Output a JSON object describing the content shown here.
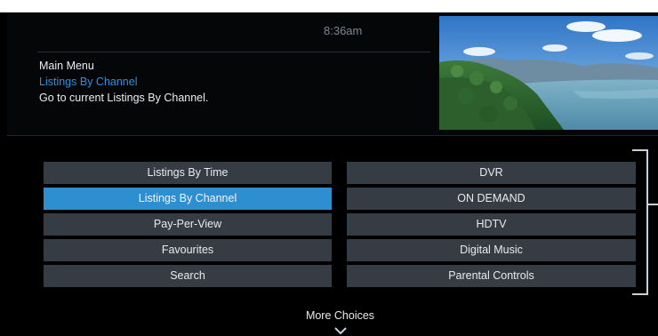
{
  "header": {
    "clock": "8:36am",
    "breadcrumb": {
      "root": "Main Menu",
      "current": "Listings By Channel",
      "description": "Go to current Listings By Channel."
    }
  },
  "menu": {
    "left": [
      {
        "label": "Listings By Time",
        "selected": false
      },
      {
        "label": "Listings By Channel",
        "selected": true
      },
      {
        "label": "Pay-Per-View",
        "selected": false
      },
      {
        "label": "Favourites",
        "selected": false
      },
      {
        "label": "Search",
        "selected": false
      }
    ],
    "right": [
      {
        "label": "DVR",
        "selected": false
      },
      {
        "label": "ON DEMAND",
        "selected": false
      },
      {
        "label": "HDTV",
        "selected": false
      },
      {
        "label": "Digital Music",
        "selected": false
      },
      {
        "label": "Parental Controls",
        "selected": false
      }
    ]
  },
  "footer": {
    "more_choices": "More Choices",
    "more_icon": "chevron-down-icon"
  },
  "colors": {
    "background": "#000000",
    "button": "#363c44",
    "selected_button": "#2e8fd0",
    "selected_text": "#2f8fd8",
    "text": "#e7ebef",
    "clock_text": "#7d8793"
  }
}
